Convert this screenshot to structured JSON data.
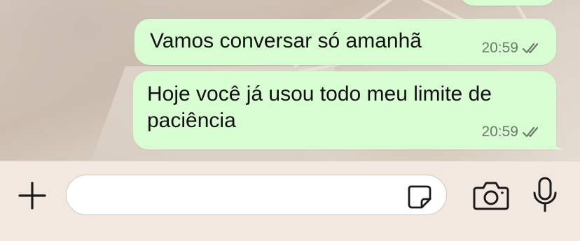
{
  "messages": [
    {
      "text": "Vamos conversar só amanhã",
      "time": "20:59",
      "status_icon": "double-check-icon"
    },
    {
      "text": "Hoje você já usou todo meu limite de\npaciência",
      "time": "20:59",
      "status_icon": "double-check-icon"
    }
  ],
  "composer": {
    "message_value": "",
    "placeholder": "",
    "icons": [
      "plus-icon",
      "sticker-icon",
      "camera-icon",
      "microphone-icon"
    ]
  },
  "colors": {
    "outgoing_bubble": "#d9fdd3",
    "bar_background": "#f2e8e0",
    "meta_text": "#6b7a6b"
  }
}
